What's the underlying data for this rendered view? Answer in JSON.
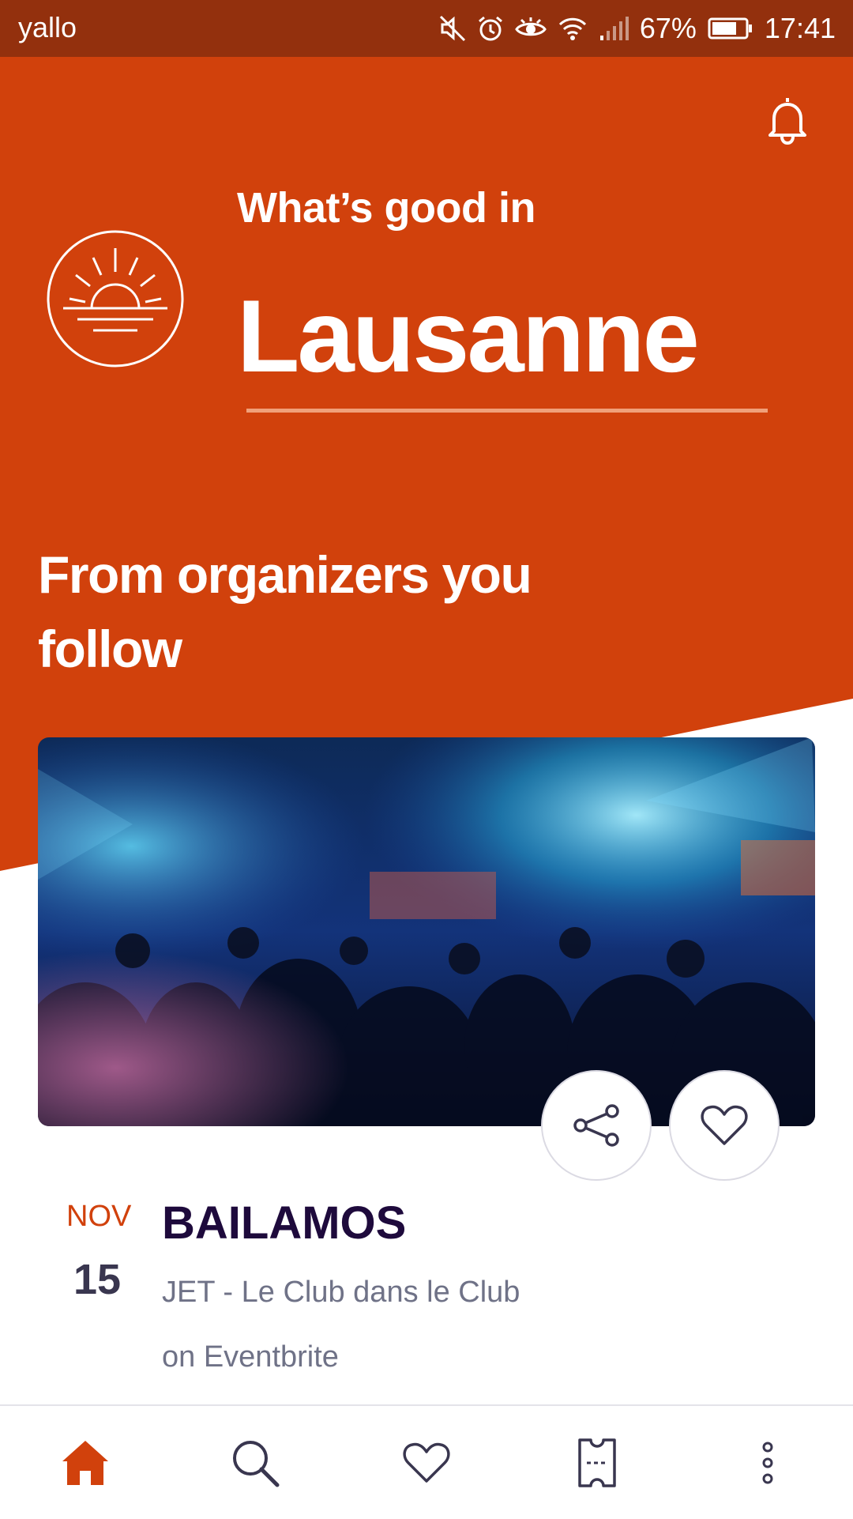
{
  "status_bar": {
    "carrier": "yallo",
    "battery": "67%",
    "time": "17:41"
  },
  "header": {
    "subtitle": "What’s good in",
    "city": "Lausanne"
  },
  "section": {
    "title": "From organizers you follow"
  },
  "event": {
    "month": "NOV",
    "day": "15",
    "title": "BAILAMOS",
    "venue": "JET - Le Club dans le Club",
    "source": "on Eventbrite"
  },
  "colors": {
    "brand_orange": "#d1410c",
    "status_bar": "#93300d",
    "title_dark": "#1e0a3c"
  },
  "icons": {
    "notification": "bell-icon",
    "logo": "sunrise-icon",
    "share": "share-icon",
    "like": "heart-icon",
    "nav": [
      "home-icon",
      "search-icon",
      "heart-icon",
      "ticket-icon",
      "more-icon"
    ]
  },
  "bottom_nav": {
    "active": "home"
  }
}
